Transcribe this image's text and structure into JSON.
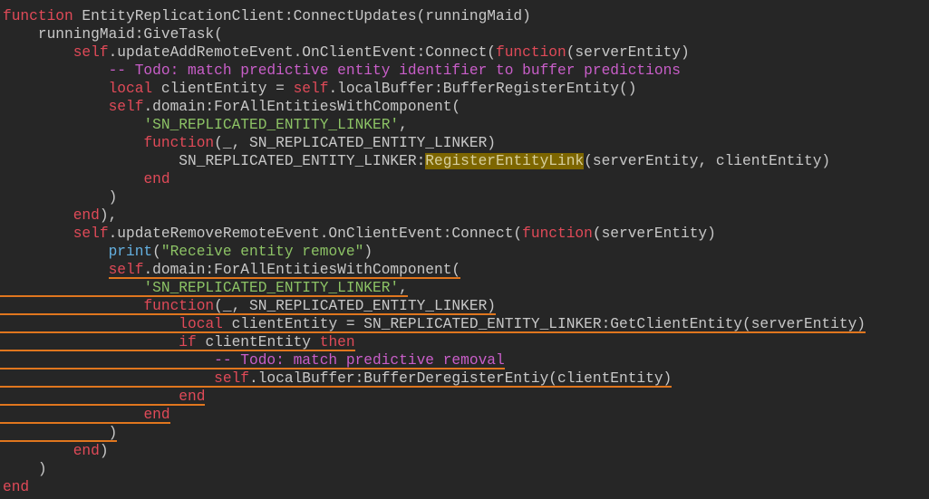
{
  "editor": {
    "language": "lua",
    "colors": {
      "background": "#262626",
      "keyword": "#e04a58",
      "string": "#8cc265",
      "comment": "#c95ec9",
      "builtin": "#64b0e0",
      "text": "#c8c8c8",
      "highlight": "#7d6600",
      "diagnostic_underline": "#e0761e"
    },
    "lines": [
      {
        "indent": 0,
        "tokens": [
          [
            "k",
            "function"
          ],
          [
            "t",
            " EntityReplicationClient:ConnectUpdates(runningMaid)"
          ]
        ]
      },
      {
        "indent": 4,
        "tokens": [
          [
            "t",
            "runningMaid:GiveTask("
          ]
        ]
      },
      {
        "indent": 8,
        "tokens": [
          [
            "k",
            "self"
          ],
          [
            "t",
            ".updateAddRemoteEvent.OnClientEvent:Connect("
          ],
          [
            "k",
            "function"
          ],
          [
            "t",
            "(serverEntity)"
          ]
        ]
      },
      {
        "indent": 12,
        "tokens": [
          [
            "c",
            "-- Todo: match predictive entity identifier to buffer predictions"
          ]
        ]
      },
      {
        "indent": 12,
        "tokens": [
          [
            "k",
            "local"
          ],
          [
            "t",
            " clientEntity = "
          ],
          [
            "k",
            "self"
          ],
          [
            "t",
            ".localBuffer:BufferRegisterEntity()"
          ]
        ]
      },
      {
        "indent": 12,
        "tokens": [
          [
            "k",
            "self"
          ],
          [
            "t",
            ".domain:ForAllEntitiesWithComponent("
          ]
        ]
      },
      {
        "indent": 16,
        "tokens": [
          [
            "s",
            "'SN_REPLICATED_ENTITY_LINKER'"
          ],
          [
            "t",
            ","
          ]
        ]
      },
      {
        "indent": 16,
        "tokens": [
          [
            "k",
            "function"
          ],
          [
            "t",
            "(_, SN_REPLICATED_ENTITY_LINKER)"
          ]
        ]
      },
      {
        "indent": 20,
        "tokens": [
          [
            "t",
            "SN_REPLICATED_ENTITY_LINKER:"
          ],
          [
            "h",
            "RegisterEntityLink"
          ],
          [
            "t",
            "(serverEntity, clientEntity)"
          ]
        ]
      },
      {
        "indent": 16,
        "tokens": [
          [
            "k",
            "end"
          ]
        ]
      },
      {
        "indent": 12,
        "tokens": [
          [
            "t",
            ")"
          ]
        ]
      },
      {
        "indent": 8,
        "tokens": [
          [
            "k",
            "end"
          ],
          [
            "t",
            "),"
          ]
        ]
      },
      {
        "indent": 8,
        "tokens": [
          [
            "k",
            "self"
          ],
          [
            "t",
            ".updateRemoveRemoteEvent.OnClientEvent:Connect("
          ],
          [
            "k",
            "function"
          ],
          [
            "t",
            "(serverEntity)"
          ]
        ]
      },
      {
        "indent": 12,
        "tokens": [
          [
            "b",
            "print"
          ],
          [
            "t",
            "("
          ],
          [
            "s",
            "\"Receive entity remove\""
          ],
          [
            "t",
            ")"
          ]
        ]
      },
      {
        "indent": 12,
        "underline": "text",
        "tokens": [
          [
            "k",
            "self"
          ],
          [
            "t",
            ".domain:ForAllEntitiesWithComponent("
          ]
        ]
      },
      {
        "indent": 16,
        "underline": "full",
        "tokens": [
          [
            "s",
            "'SN_REPLICATED_ENTITY_LINKER'"
          ],
          [
            "t",
            ","
          ]
        ]
      },
      {
        "indent": 16,
        "underline": "full",
        "tokens": [
          [
            "k",
            "function"
          ],
          [
            "t",
            "(_, SN_REPLICATED_ENTITY_LINKER)"
          ]
        ]
      },
      {
        "indent": 20,
        "underline": "full",
        "tokens": [
          [
            "k",
            "local"
          ],
          [
            "t",
            " clientEntity = SN_REPLICATED_ENTITY_LINKER:GetClientEntity(serverEntity)"
          ]
        ]
      },
      {
        "indent": 20,
        "underline": "full",
        "tokens": [
          [
            "k",
            "if"
          ],
          [
            "t",
            " clientEntity "
          ],
          [
            "k",
            "then"
          ]
        ]
      },
      {
        "indent": 24,
        "underline": "full",
        "tokens": [
          [
            "c",
            "-- Todo: match predictive removal"
          ]
        ]
      },
      {
        "indent": 24,
        "underline": "full",
        "tokens": [
          [
            "k",
            "self"
          ],
          [
            "t",
            ".localBuffer:BufferDeregisterEntiy(clientEntity)"
          ]
        ]
      },
      {
        "indent": 20,
        "underline": "full",
        "tokens": [
          [
            "k",
            "end"
          ]
        ]
      },
      {
        "indent": 16,
        "underline": "full",
        "tokens": [
          [
            "k",
            "end"
          ]
        ]
      },
      {
        "indent": 12,
        "underline": "full",
        "tokens": [
          [
            "t",
            ")"
          ]
        ]
      },
      {
        "indent": 8,
        "tokens": [
          [
            "k",
            "end"
          ],
          [
            "t",
            ")"
          ]
        ]
      },
      {
        "indent": 4,
        "tokens": [
          [
            "t",
            ")"
          ]
        ]
      },
      {
        "indent": 0,
        "tokens": [
          [
            "k",
            "end"
          ]
        ]
      }
    ]
  }
}
